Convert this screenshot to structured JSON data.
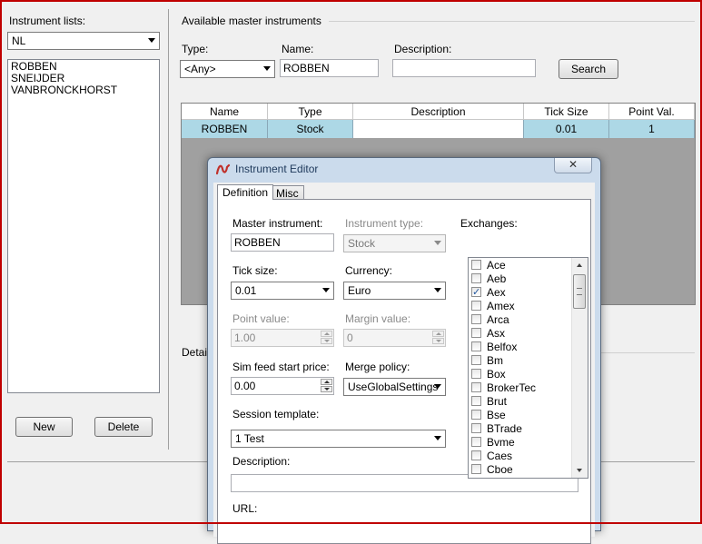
{
  "left_panel": {
    "instrument_lists_label": "Instrument lists:",
    "selected_list": "NL",
    "instruments": [
      "ROBBEN",
      "SNEIJDER",
      "VANBRONCKHORST"
    ],
    "new_button": "New",
    "delete_button": "Delete"
  },
  "master_group": {
    "title": "Available master instruments",
    "type_label": "Type:",
    "type_value": "<Any>",
    "name_label": "Name:",
    "name_value": "ROBBEN",
    "description_label": "Description:",
    "description_value": "",
    "search_button": "Search",
    "columns": [
      "Name",
      "Type",
      "Description",
      "Tick Size",
      "Point Val."
    ],
    "rows": [
      {
        "name": "ROBBEN",
        "type": "Stock",
        "description": "",
        "tick_size": "0.01",
        "point_value": "1"
      }
    ],
    "details_label": "Detail"
  },
  "dialog": {
    "title": "Instrument Editor",
    "close_label": "✕",
    "tabs": [
      "Definition",
      "Misc"
    ],
    "active_tab": "Definition",
    "master_instrument_label": "Master instrument:",
    "master_instrument_value": "ROBBEN",
    "instrument_type_label": "Instrument type:",
    "instrument_type_value": "Stock",
    "tick_size_label": "Tick size:",
    "tick_size_value": "0.01",
    "currency_label": "Currency:",
    "currency_value": "Euro",
    "point_value_label": "Point value:",
    "point_value_value": "1.00",
    "margin_value_label": "Margin value:",
    "margin_value_value": "0",
    "sim_feed_label": "Sim feed start price:",
    "sim_feed_value": "0.00",
    "merge_policy_label": "Merge policy:",
    "merge_policy_value": "UseGlobalSettings",
    "session_template_label": "Session template:",
    "session_template_value": "1 Test",
    "description_label": "Description:",
    "description_value": "",
    "url_label": "URL:",
    "exchanges_label": "Exchanges:",
    "exchanges": [
      {
        "name": "Ace",
        "checked": false
      },
      {
        "name": "Aeb",
        "checked": false
      },
      {
        "name": "Aex",
        "checked": true
      },
      {
        "name": "Amex",
        "checked": false
      },
      {
        "name": "Arca",
        "checked": false
      },
      {
        "name": "Asx",
        "checked": false
      },
      {
        "name": "Belfox",
        "checked": false
      },
      {
        "name": "Bm",
        "checked": false
      },
      {
        "name": "Box",
        "checked": false
      },
      {
        "name": "BrokerTec",
        "checked": false
      },
      {
        "name": "Brut",
        "checked": false
      },
      {
        "name": "Bse",
        "checked": false
      },
      {
        "name": "BTrade",
        "checked": false
      },
      {
        "name": "Bvme",
        "checked": false
      },
      {
        "name": "Caes",
        "checked": false
      },
      {
        "name": "Cboe",
        "checked": false
      }
    ]
  }
}
